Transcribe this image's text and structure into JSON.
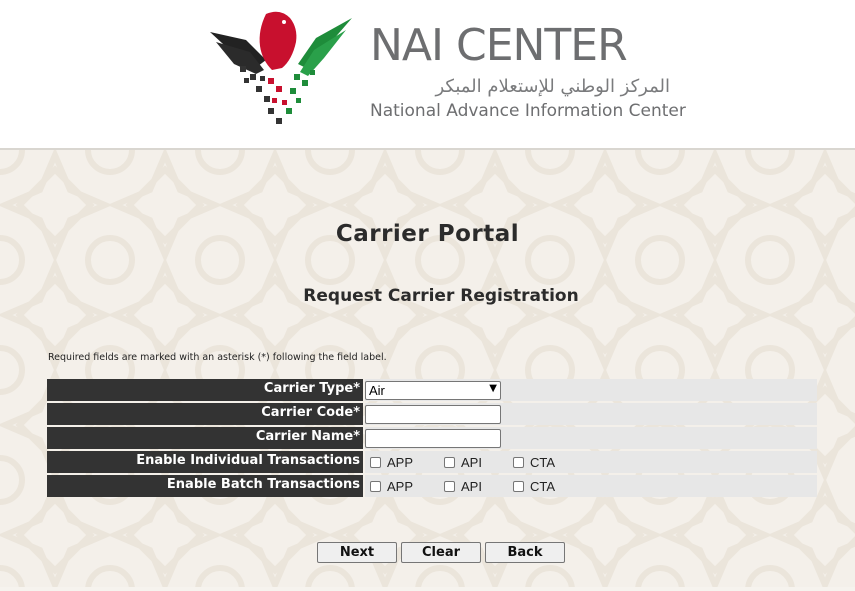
{
  "header": {
    "brand_name": "NAI CENTER",
    "brand_arabic": "المركز الوطني للإستعلام المبكر",
    "brand_english": "National Advance Information Center",
    "colors": {
      "red": "#c8102e",
      "green": "#1e8c3a",
      "black": "#222222",
      "gray": "#6d6e70"
    }
  },
  "page": {
    "title": "Carrier Portal",
    "subtitle": "Request Carrier Registration",
    "note": "Required fields are marked with an asterisk (*) following the field label."
  },
  "form": {
    "carrier_type": {
      "label": "Carrier Type*",
      "selected": "Air"
    },
    "carrier_code": {
      "label": "Carrier Code*",
      "value": ""
    },
    "carrier_name": {
      "label": "Carrier Name*",
      "value": ""
    },
    "individual": {
      "label": "Enable Individual Transactions",
      "options": [
        "APP",
        "API",
        "CTA"
      ]
    },
    "batch": {
      "label": "Enable Batch Transactions",
      "options": [
        "APP",
        "API",
        "CTA"
      ]
    }
  },
  "buttons": {
    "next": "Next",
    "clear": "Clear",
    "back": "Back"
  }
}
